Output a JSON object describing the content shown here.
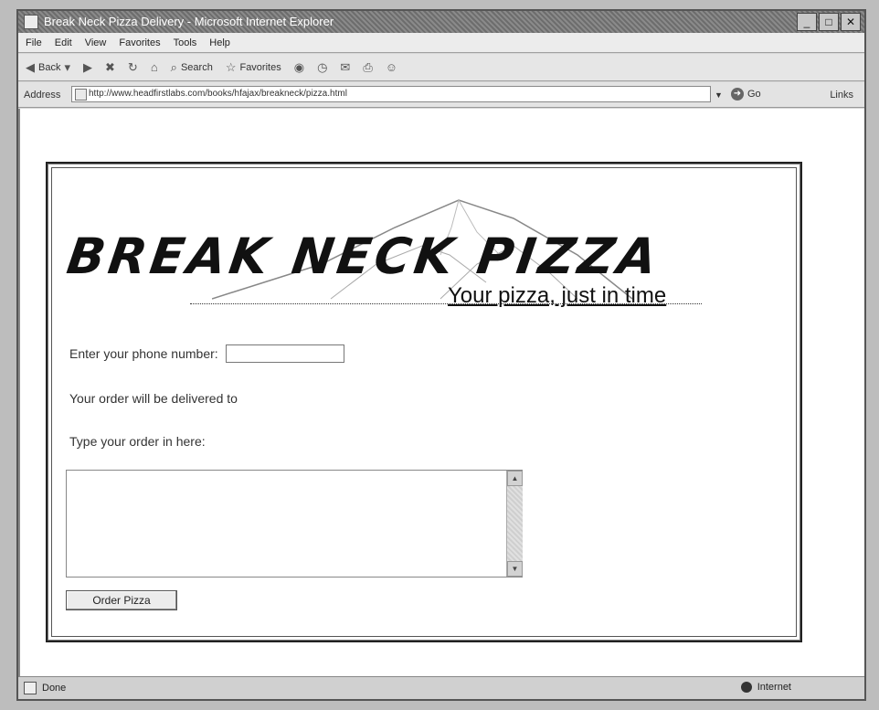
{
  "window": {
    "title": "Break Neck Pizza Delivery - Microsoft Internet Explorer",
    "buttons": {
      "minimize": "_",
      "maximize": "□",
      "close": "✕"
    }
  },
  "menu": [
    "File",
    "Edit",
    "View",
    "Favorites",
    "Tools",
    "Help"
  ],
  "toolbar": {
    "back": "Back",
    "search": "Search",
    "favorites": "Favorites"
  },
  "address": {
    "label": "Address",
    "url": "http://www.headfirstlabs.com/books/hfajax/breakneck/pizza.html",
    "go": "Go",
    "links": "Links"
  },
  "page": {
    "logo": "BREAK NECK PIZZA",
    "tagline": "Your pizza, just in time",
    "phone_label": "Enter your phone number:",
    "phone_value": "",
    "delivery_text": "Your order will be delivered to",
    "order_label": "Type your order in here:",
    "order_value": "",
    "order_button": "Order Pizza"
  },
  "status": {
    "left": "Done",
    "right": "Internet"
  }
}
